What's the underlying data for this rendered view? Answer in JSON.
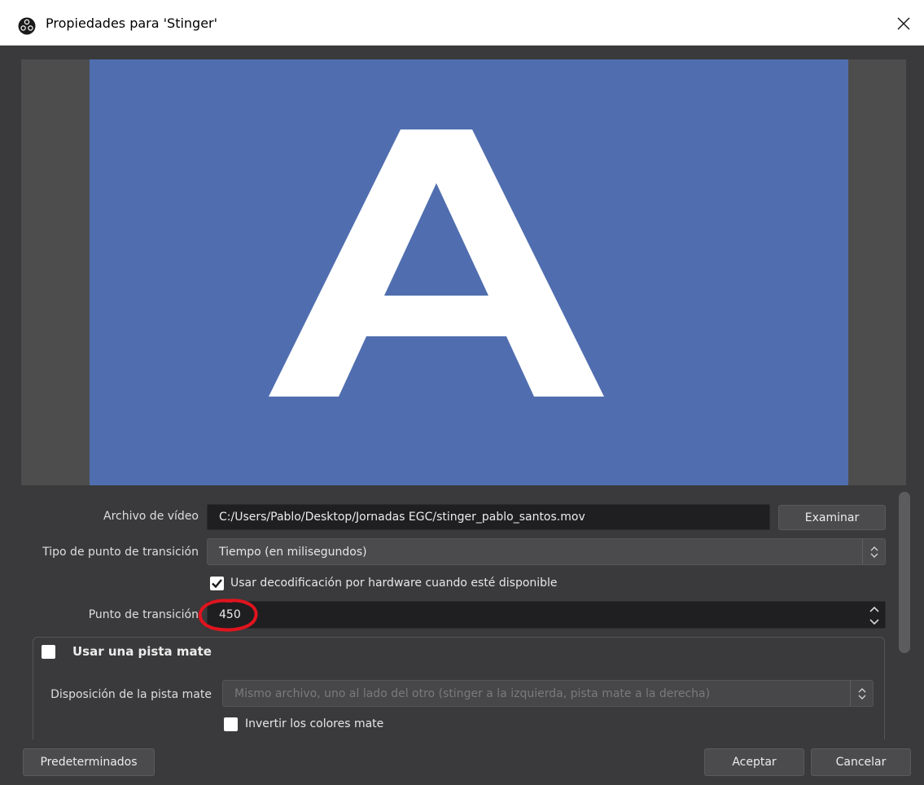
{
  "window": {
    "title": "Propiedades para 'Stinger'",
    "icon": "obs-logo-icon",
    "close_icon": "close-icon"
  },
  "preview": {
    "letter": "A",
    "background_color": "#506eaf",
    "letter_color": "#ffffff"
  },
  "form": {
    "video_file": {
      "label": "Archivo de vídeo",
      "value": "C:/Users/Pablo/Desktop/Jornadas EGC/stinger_pablo_santos.mov",
      "browse_label": "Examinar"
    },
    "transition_point_type": {
      "label": "Tipo de punto de transición",
      "value": "Tiempo (en milisegundos)"
    },
    "hardware_decoding": {
      "label": "Usar decodificación por hardware cuando esté disponible",
      "checked": true
    },
    "transition_point": {
      "label": "Punto de transición",
      "value": "450",
      "annotation_color": "#e0141e"
    },
    "track_matte": {
      "title": "Usar una pista mate",
      "checked": false,
      "layout_label": "Disposición de la pista mate",
      "layout_value": "Mismo archivo, uno al lado del otro (stinger a la izquierda, pista mate a la derecha)",
      "invert_label": "Invertir los colores mate",
      "invert_checked": false
    }
  },
  "buttons": {
    "defaults": "Predeterminados",
    "accept": "Aceptar",
    "cancel": "Cancelar"
  }
}
